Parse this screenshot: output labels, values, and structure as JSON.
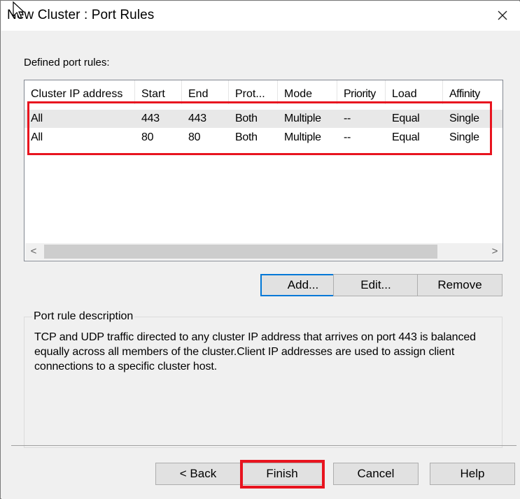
{
  "window": {
    "title": "New Cluster :  Port Rules"
  },
  "main": {
    "defined_label": "Defined port rules:",
    "columns": [
      "Cluster IP address",
      "Start",
      "End",
      "Prot...",
      "Mode",
      "Priority",
      "Load",
      "Affinity"
    ],
    "rows": [
      [
        "All",
        "443",
        "443",
        "Both",
        "Multiple",
        "--",
        "Equal",
        "Single"
      ],
      [
        "All",
        "80",
        "80",
        "Both",
        "Multiple",
        "--",
        "Equal",
        "Single"
      ]
    ],
    "scroll_left": "<",
    "scroll_right": ">",
    "buttons": {
      "add": "Add...",
      "edit": "Edit...",
      "remove": "Remove"
    },
    "description": {
      "title": "Port rule description",
      "text": "TCP and UDP traffic directed to any cluster IP address that arrives on port 443 is balanced equally across all members of the cluster.Client IP addresses are used to assign client connections to a specific cluster host."
    }
  },
  "footer": {
    "back": "< Back",
    "finish": "Finish",
    "cancel": "Cancel",
    "help": "Help"
  },
  "colors": {
    "highlight": "#e8141f",
    "focus": "#0078d7"
  }
}
